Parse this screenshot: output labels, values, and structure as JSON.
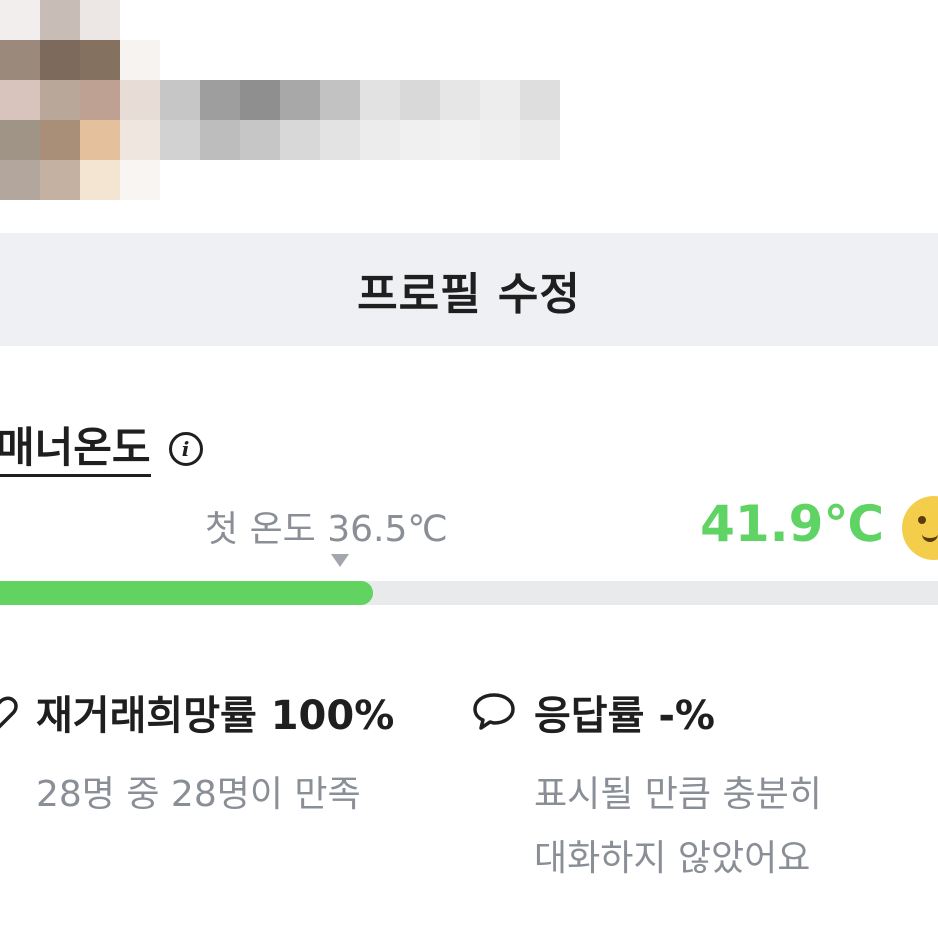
{
  "profile": {
    "edit_button_label": "프로필 수정"
  },
  "manner": {
    "title": "매너온도",
    "first_temp_label": "첫 온도 36.5℃",
    "current_temp": "41.9℃",
    "progress_fraction": 0.419,
    "bar_color": "#62d260",
    "temp_color": "#5fd363"
  },
  "stats": {
    "repurchase": {
      "label": "재거래희망률 100%",
      "detail": "28명 중 28명이 만족",
      "icon": "heart-icon"
    },
    "response": {
      "label": "응답률 -%",
      "detail_line1": "표시될 만큼 충분히",
      "detail_line2": "대화하지 않았어요",
      "icon": "chat-bubble-icon"
    }
  },
  "icons": {
    "info": "info-icon",
    "face": "smiley-face-icon"
  }
}
